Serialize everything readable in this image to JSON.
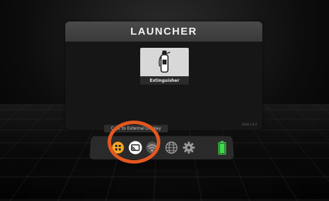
{
  "launcher": {
    "title": "LAUNCHER",
    "apps": [
      {
        "label": "Extinguisher",
        "icon": "fire-extinguisher-icon"
      }
    ],
    "version": "2024.2.0.3"
  },
  "tooltip": {
    "text": "Cast to External Display"
  },
  "taskbar": {
    "items": [
      {
        "name": "apps-grid-icon",
        "color": "#f5a623"
      },
      {
        "name": "cast-icon",
        "color": "#ffffff"
      },
      {
        "name": "wifi-icon",
        "color": "#9a9a9a"
      },
      {
        "name": "globe-icon",
        "color": "#9a9a9a"
      },
      {
        "name": "gear-icon",
        "color": "#9a9a9a"
      },
      {
        "name": "battery-icon",
        "color": "#3ddc4a"
      }
    ]
  },
  "highlight": {
    "color": "#e2581f"
  }
}
